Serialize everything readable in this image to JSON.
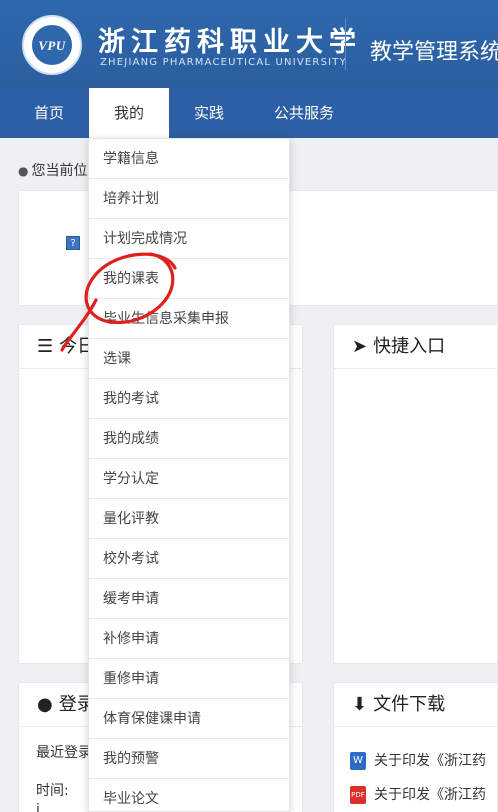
{
  "header": {
    "logo_text": "VPU",
    "university_cn": "浙江药科职业大学",
    "university_en": "ZHEJIANG PHARMACEUTICAL UNIVERSITY",
    "system_title": "教学管理系统"
  },
  "nav": {
    "items": [
      {
        "label": "首页"
      },
      {
        "label": "我的"
      },
      {
        "label": "实践"
      },
      {
        "label": "公共服务"
      }
    ]
  },
  "breadcrumb": {
    "text": "您当前位"
  },
  "cards": {
    "today": {
      "title": "今日"
    },
    "quick_entry": {
      "title": "快捷入口"
    },
    "login": {
      "title": "登录",
      "recent_login": "最近登录",
      "time_label": "时间:",
      "row3": "i"
    },
    "downloads": {
      "title": "文件下载",
      "files": [
        {
          "type": "W",
          "name": "关于印发《浙江药",
          "color": "#2b6cc4"
        },
        {
          "type": "PDF",
          "name": "关于印发《浙江药",
          "color": "#d9302c"
        }
      ]
    }
  },
  "dropdown": {
    "items": [
      "学籍信息",
      "培养计划",
      "计划完成情况",
      "我的课表",
      "毕业生信息采集申报",
      "选课",
      "我的考试",
      "我的成绩",
      "学分认定",
      "量化评教",
      "校外考试",
      "缓考申请",
      "补修申请",
      "重修申请",
      "体育保健课申请",
      "我的预警",
      "毕业论文"
    ]
  },
  "colors": {
    "header_blue": "#2f67ad",
    "nav_blue": "#2c5fa3",
    "annotation_red": "#e0201e"
  },
  "icons": {
    "breadcrumb": "map-pin-icon",
    "today": "list-icon",
    "quick_entry": "paper-plane-icon",
    "login": "user-icon",
    "downloads": "download-icon",
    "help": "help-icon"
  }
}
